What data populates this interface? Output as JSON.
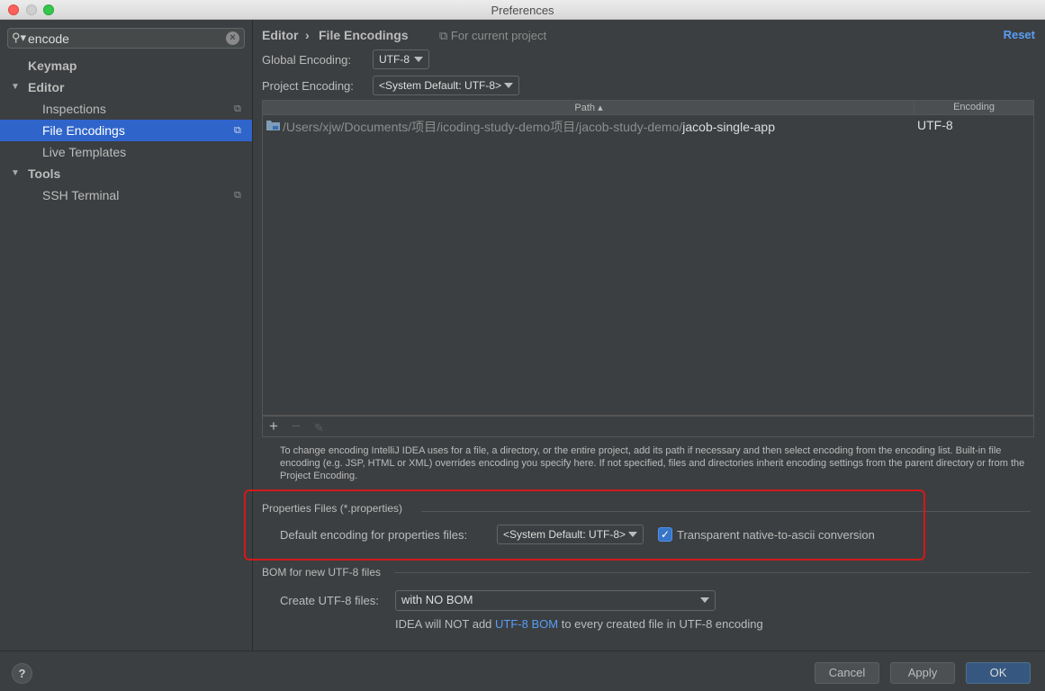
{
  "window": {
    "title": "Preferences"
  },
  "sidebar": {
    "search_value": "encode",
    "items": [
      {
        "label": "Keymap"
      },
      {
        "label": "Editor"
      },
      {
        "label": "Inspections"
      },
      {
        "label": "File Encodings"
      },
      {
        "label": "Live Templates"
      },
      {
        "label": "Tools"
      },
      {
        "label": "SSH Terminal"
      }
    ]
  },
  "header": {
    "breadcrumb_parent": "Editor",
    "breadcrumb_sep": "›",
    "breadcrumb_current": "File Encodings",
    "for_current_project": "For current project",
    "reset_label": "Reset"
  },
  "encoding": {
    "global_label": "Global Encoding:",
    "global_value": "UTF-8",
    "project_label": "Project Encoding:",
    "project_value": "<System Default: UTF-8>"
  },
  "table": {
    "col_path": "Path ▴",
    "col_encoding": "Encoding",
    "rows": [
      {
        "path_prefix": "/Users/xjw/Documents/项目/icoding-study-demo项目/jacob-study-demo/",
        "path_name": "jacob-single-app",
        "encoding": "UTF-8"
      }
    ],
    "toolbar": {
      "add": "+",
      "remove": "−",
      "edit": "✎"
    }
  },
  "help_text": "To change encoding IntelliJ IDEA uses for a file, a directory, or the entire project, add its path if necessary and then select encoding from the encoding list. Built-in file encoding (e.g. JSP, HTML or XML) overrides encoding you specify here. If not specified, files and directories inherit encoding settings from the parent directory or from the Project Encoding.",
  "properties": {
    "group_title": "Properties Files (*.properties)",
    "default_label": "Default encoding for properties files:",
    "default_value": "<System Default: UTF-8>",
    "checkbox_label": "Transparent native-to-ascii conversion",
    "checkbox_checked": true
  },
  "bom": {
    "group_title": "BOM for new UTF-8 files",
    "create_label": "Create UTF-8 files:",
    "create_value": "with NO BOM",
    "note_prefix": "IDEA will NOT add ",
    "note_link": "UTF-8 BOM",
    "note_suffix": " to every created file in UTF-8 encoding"
  },
  "footer": {
    "help": "?",
    "cancel": "Cancel",
    "apply": "Apply",
    "ok": "OK"
  },
  "colors": {
    "accent": "#2f65ca",
    "link": "#589df6",
    "highlight_box": "#d2191b",
    "background": "#3c3f41"
  }
}
